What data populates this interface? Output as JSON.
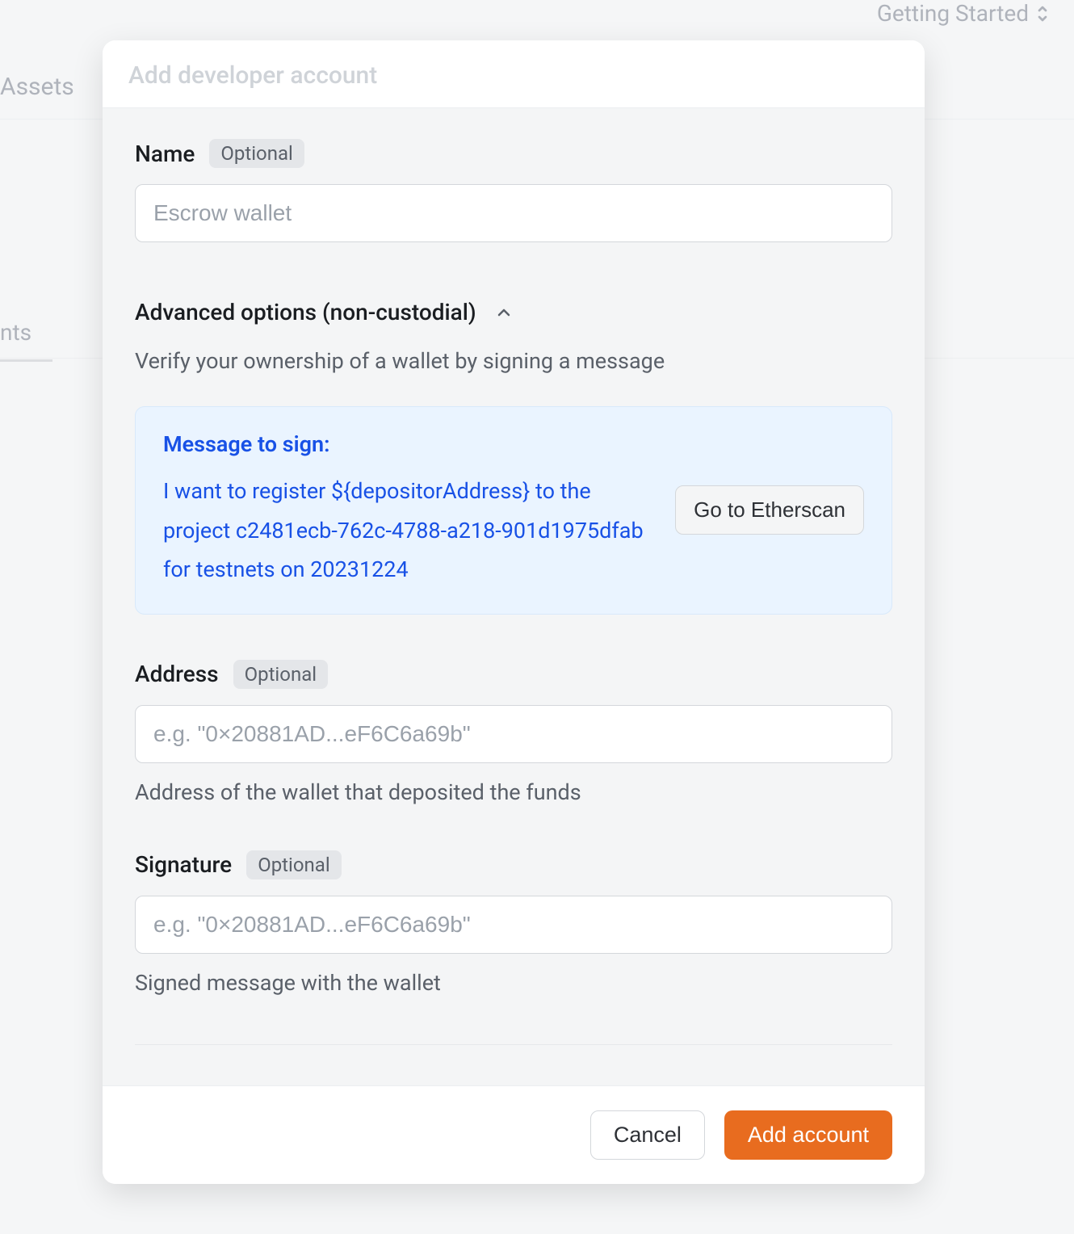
{
  "background": {
    "getting_started": "Getting Started",
    "assets": "Assets",
    "tab_fragment": "nts"
  },
  "modal": {
    "title": "Add developer account",
    "optional_label": "Optional",
    "name": {
      "label": "Name",
      "placeholder": "Escrow wallet"
    },
    "advanced": {
      "title": "Advanced options (non-custodial)",
      "desc": "Verify your ownership of a wallet by signing a message",
      "info_heading": "Message to sign:",
      "info_body": "I want to register ${depositorAddress} to the project c2481ecb-762c-4788-a218-901d1975dfab for testnets on 20231224",
      "etherscan_btn": "Go to Etherscan"
    },
    "address": {
      "label": "Address",
      "placeholder": "e.g. \"0×20881AD...eF6C6a69b\"",
      "help": "Address of the wallet that deposited the funds"
    },
    "signature": {
      "label": "Signature",
      "placeholder": "e.g. \"0×20881AD...eF6C6a69b\"",
      "help": "Signed message with the wallet"
    },
    "footer": {
      "cancel": "Cancel",
      "submit": "Add account"
    }
  }
}
